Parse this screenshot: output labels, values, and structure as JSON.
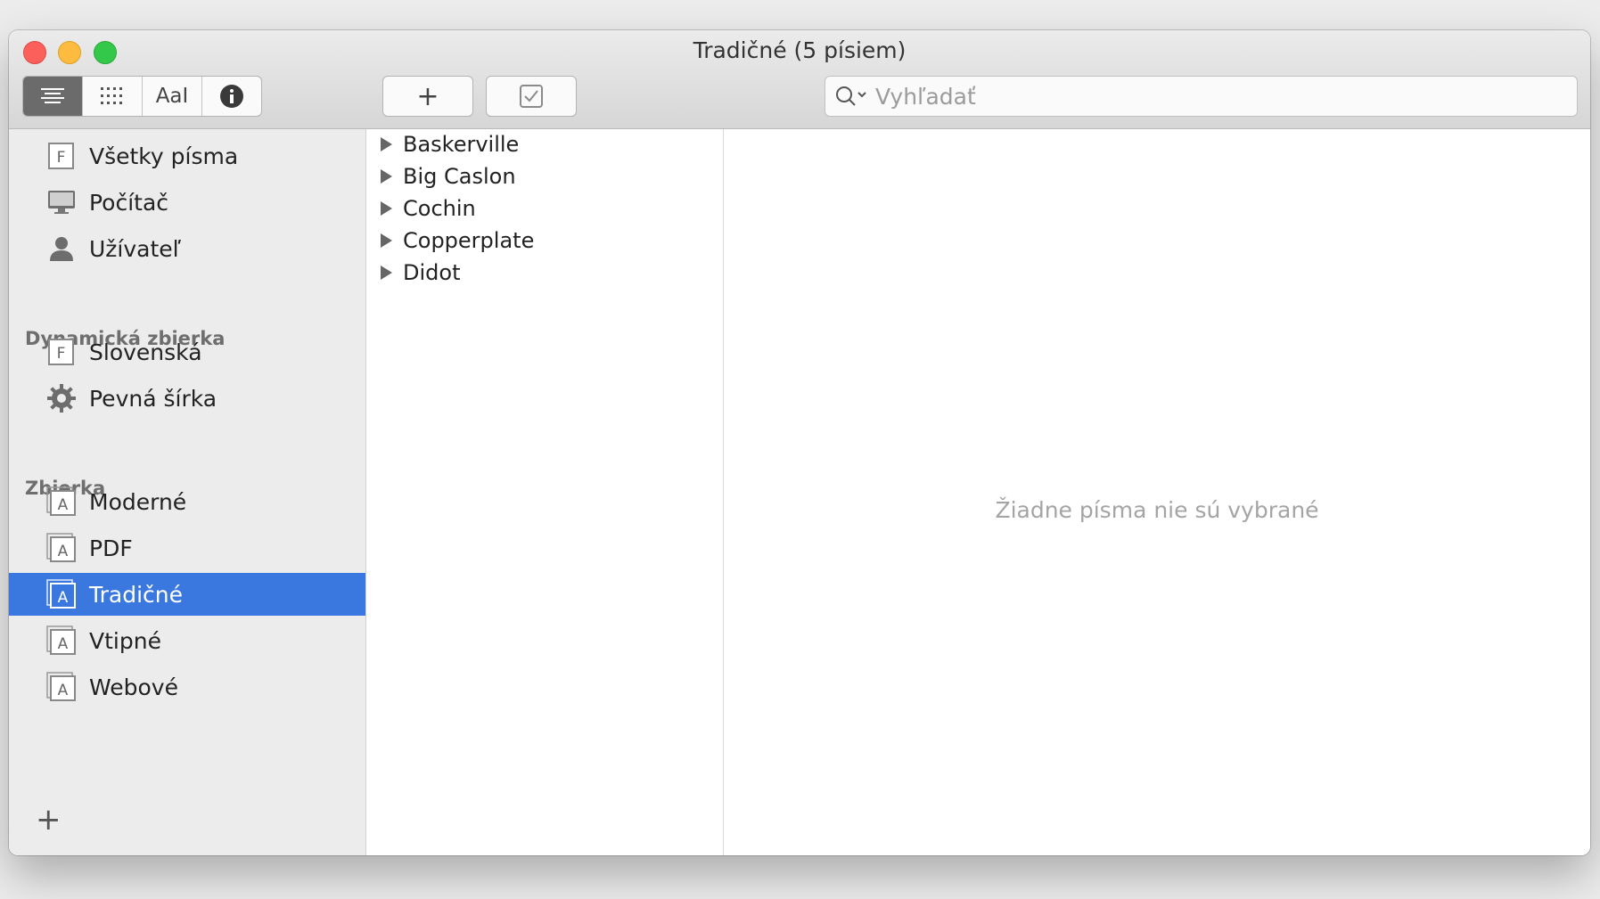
{
  "window": {
    "title": "Tradičné (5 písiem)"
  },
  "toolbar": {
    "view_modes": [
      {
        "name": "list-view",
        "icon": "list-lines-icon",
        "active": true
      },
      {
        "name": "grid-view",
        "icon": "grid-dots-icon",
        "active": false
      },
      {
        "name": "sample-view",
        "label": "AaI",
        "active": false
      },
      {
        "name": "info-view",
        "icon": "info-icon",
        "active": false
      }
    ],
    "add_label": "+",
    "validate_icon": "checkbox-icon",
    "search_placeholder": "Vyhľadať"
  },
  "sidebar": {
    "library": [
      {
        "label": "Všetky písma",
        "icon": "font-book-icon"
      },
      {
        "label": "Počítač",
        "icon": "computer-icon"
      },
      {
        "label": "Užívateľ",
        "icon": "user-icon"
      }
    ],
    "smart_header": "Dynamická zbierka",
    "smart": [
      {
        "label": "Slovenská",
        "icon": "font-book-icon"
      },
      {
        "label": "Pevná šírka",
        "icon": "gear-icon"
      }
    ],
    "collection_header": "Zbierka",
    "collections": [
      {
        "label": "Moderné",
        "icon": "collection-icon"
      },
      {
        "label": "PDF",
        "icon": "collection-icon"
      },
      {
        "label": "Tradičné",
        "icon": "collection-icon",
        "selected": true
      },
      {
        "label": "Vtipné",
        "icon": "collection-icon"
      },
      {
        "label": "Webové",
        "icon": "collection-icon"
      }
    ],
    "add_label": "+"
  },
  "fonts": [
    "Baskerville",
    "Big Caslon",
    "Cochin",
    "Copperplate",
    "Didot"
  ],
  "preview": {
    "empty_message": "Žiadne písma nie sú vybrané"
  },
  "colors": {
    "selection": "#3a78e0",
    "sidebar_bg": "#ececec",
    "close": "#fc605b",
    "minimize": "#fdbc40",
    "zoom": "#34c84a"
  }
}
